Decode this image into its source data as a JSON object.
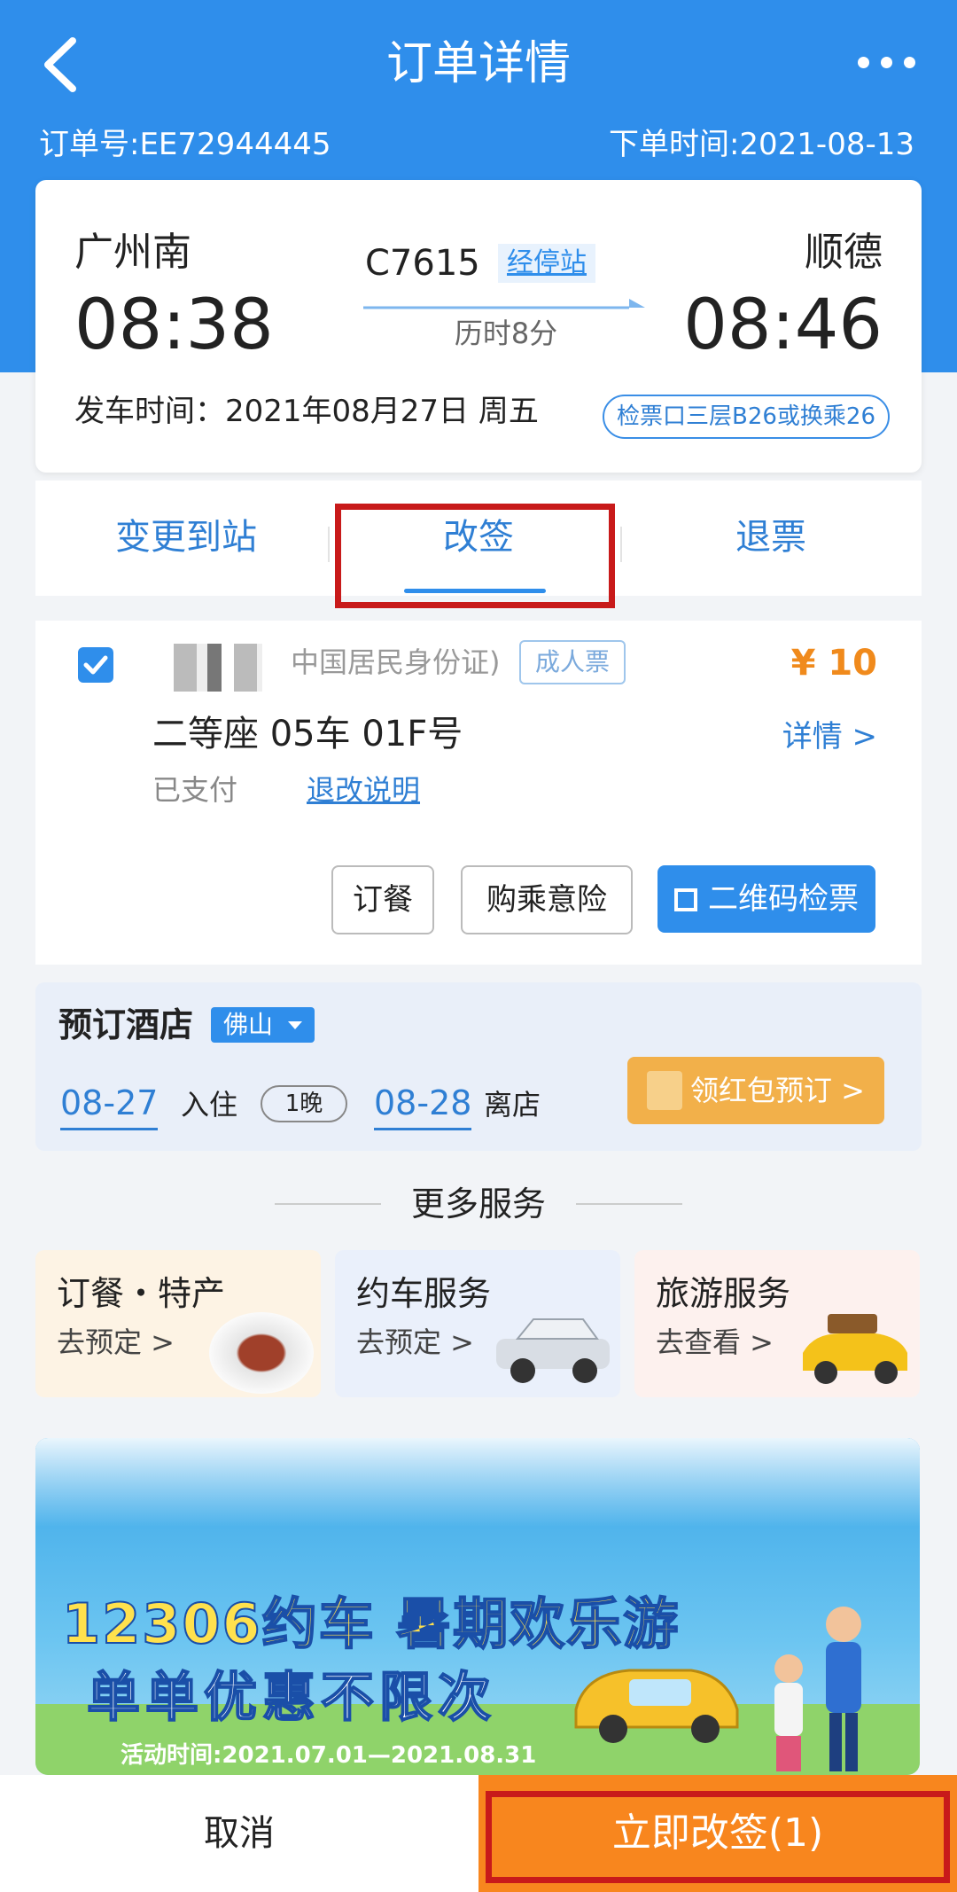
{
  "header": {
    "title": "订单详情",
    "order_no": "订单号:EE72944445",
    "order_time": "下单时间:2021-08-13",
    "icons": {
      "back": "back-arrow-icon",
      "more": "more-dots-icon"
    }
  },
  "trip": {
    "from_station": "广州南",
    "to_station": "顺德",
    "depart_time": "08:38",
    "arrive_time": "08:46",
    "train_no": "C7615",
    "stops_link": "经停站",
    "duration": "历时8分",
    "departure_date": "发车时间：2021年08月27日 周五",
    "gate": "检票口三层B26或换乘26"
  },
  "tabs": [
    {
      "label": "变更到站"
    },
    {
      "label": "改签",
      "active": true
    },
    {
      "label": "退票"
    }
  ],
  "passenger": {
    "id_text": "中国居民身份证)",
    "ticket_type": "成人票",
    "price": "¥ 10",
    "seat": "二等座 05车 01F号",
    "detail_link": "详情 >",
    "status": "已支付",
    "rules_link": "退改说明",
    "checked": true
  },
  "actions": {
    "meal": "订餐",
    "insurance": "购乘意险",
    "qr": "二维码检票"
  },
  "hotel": {
    "title": "预订酒店",
    "city": "佛山",
    "checkin_date": "08-27",
    "checkin_label": "入住",
    "nights": "1晚",
    "checkout_date": "08-28",
    "checkout_label": "离店",
    "redpack_button": "领红包预订 >"
  },
  "more_services": {
    "title": "更多服务",
    "cards": [
      {
        "title": "订餐・特产",
        "sub": "去预定 >",
        "bg": "#fdf3e4"
      },
      {
        "title": "约车服务",
        "sub": "去预定 >",
        "bg": "#eaf0fb"
      },
      {
        "title": "旅游服务",
        "sub": "去查看 >",
        "bg": "#fdf1ee"
      }
    ]
  },
  "banner": {
    "line1": "12306约车 暑期欢乐游",
    "line2": "单单优惠不限次",
    "period": "活动时间:2021.07.01—2021.08.31"
  },
  "bottom": {
    "cancel": "取消",
    "confirm": "立即改签(1)"
  },
  "colors": {
    "primary": "#2f8eeb",
    "accent_orange": "#f8861e",
    "highlight_red": "#c81a1a"
  }
}
